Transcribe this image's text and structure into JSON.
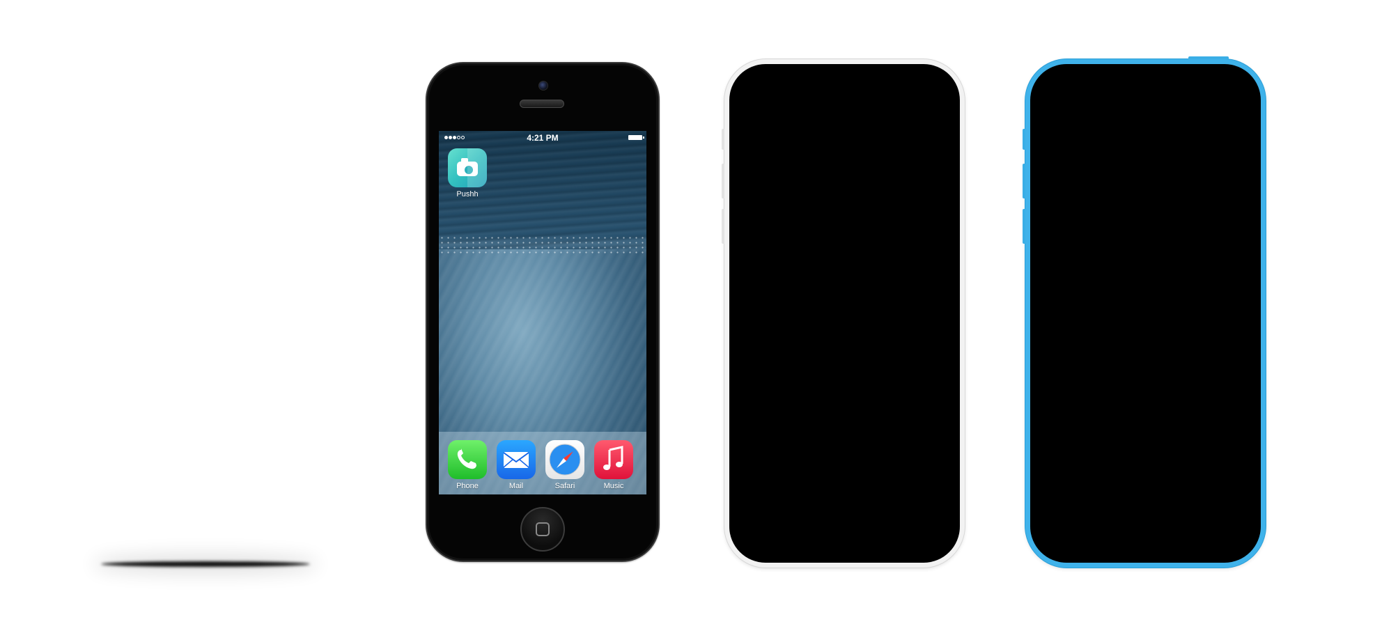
{
  "status_bar": {
    "signal_bars_filled": 3,
    "signal_bars_total": 5,
    "time": "4:21 PM",
    "battery_icon": "battery-full-icon"
  },
  "home_screen": {
    "apps": [
      {
        "label": "Pushh",
        "icon": "camera-icon"
      }
    ],
    "dock": [
      {
        "label": "Phone",
        "icon": "phone-handset-icon"
      },
      {
        "label": "Mail",
        "icon": "envelope-icon"
      },
      {
        "label": "Safari",
        "icon": "compass-icon"
      },
      {
        "label": "Music",
        "icon": "music-note-icon"
      }
    ]
  },
  "colors": {
    "black_body": "#050505",
    "white_body": "#f2f2f2",
    "blue_body": "#3fb2ea",
    "pushh_icon": "#33c0c0",
    "phone_icon": "#1fbd2a",
    "mail_icon": "#1867e8",
    "music_icon": "#e0123a"
  }
}
